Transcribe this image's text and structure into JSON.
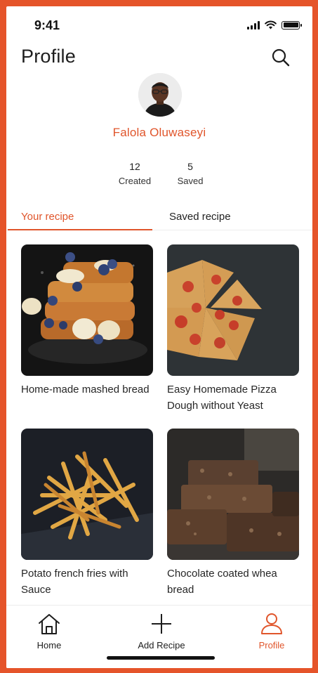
{
  "status_bar": {
    "time": "9:41"
  },
  "header": {
    "title": "Profile",
    "search_icon": "search-icon"
  },
  "profile": {
    "name": "Falola Oluwaseyi",
    "stats": [
      {
        "count": "12",
        "label": "Created"
      },
      {
        "count": "5",
        "label": "Saved"
      }
    ]
  },
  "tabs": [
    {
      "label": "Your recipe",
      "active": true
    },
    {
      "label": "Saved recipe",
      "active": false
    }
  ],
  "recipes": [
    {
      "title": "Home-made mashed bread"
    },
    {
      "title": "Easy Homemade Pizza Dough without Yeast"
    },
    {
      "title": "Potato french fries with Sauce"
    },
    {
      "title": "Chocolate coated whea bread"
    }
  ],
  "bottom_nav": [
    {
      "label": "Home",
      "icon": "home-icon",
      "active": false
    },
    {
      "label": "Add Recipe",
      "icon": "plus-icon",
      "active": false
    },
    {
      "label": "Profile",
      "icon": "user-icon",
      "active": true
    }
  ],
  "colors": {
    "accent": "#e0552b",
    "frame": "#e5542a"
  }
}
